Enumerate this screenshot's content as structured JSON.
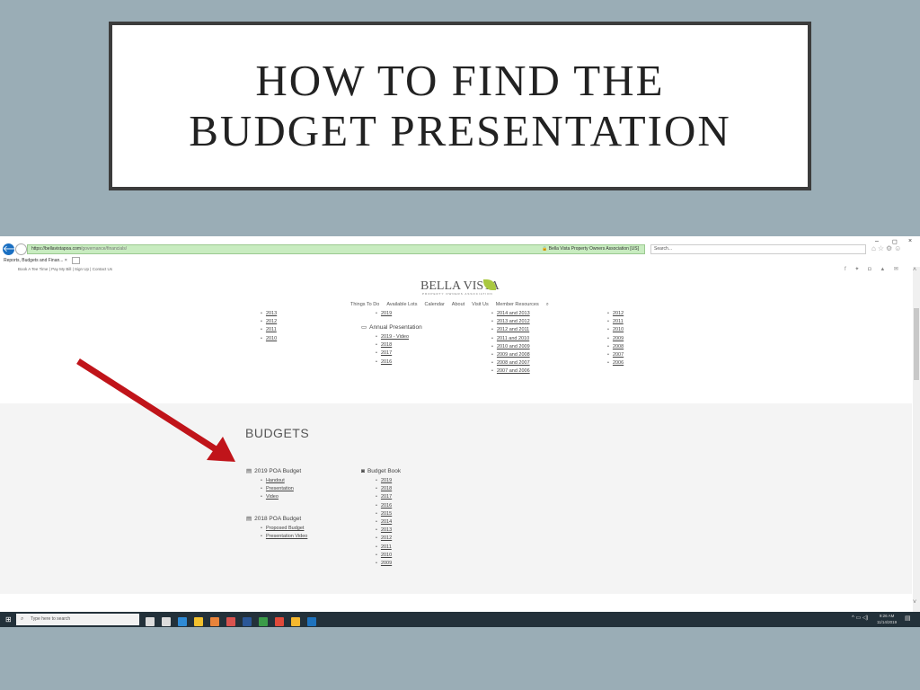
{
  "slide": {
    "title_line1": "HOW TO FIND THE",
    "title_line2": "BUDGET PRESENTATION"
  },
  "browser": {
    "back_glyph": "🡐",
    "address_url_strong": "https://bellavistapoa.com",
    "address_url_rest": "/governance/financials/",
    "site_identity": "Bella Vista Property Owners Association [US]",
    "search_placeholder": "Search...",
    "tab_label": "Reports, Budgets and Finan...",
    "tab_close": "×",
    "window_minimize": "–",
    "window_restore": "◻",
    "window_close": "×",
    "fav_icons": "⌂☆⚙☺"
  },
  "site": {
    "utility_links": "Book A Tee Time | Pay My Bill | Sign Up | Contact Us",
    "social_icons": "f ✦ ◘ ▲ ✉",
    "logo_text": "BELLA VISTA",
    "logo_subtext": "PROPERTY OWNERS ASSOCIATION",
    "menu": [
      "Things To Do",
      "Available Lots",
      "Calendar",
      "About",
      "Visit Us",
      "Member Resources"
    ],
    "menu_search_glyph": "⌕"
  },
  "upper_lists": {
    "col1": [
      "2013",
      "2012",
      "2011",
      "2010"
    ],
    "col2_top": [
      "2019"
    ],
    "annual_presentation_heading": "Annual Presentation",
    "annual_presentation_items": [
      "2019 - Video",
      "2018",
      "2017",
      "2016"
    ],
    "col3": [
      "2014 and 2013",
      "2013 and 2012",
      "2012 and 2011",
      "2011 and 2010",
      "2010 and 2009",
      "2009 and 2008",
      "2008 and 2007",
      "2007 and 2006"
    ],
    "col4": [
      "2012",
      "2011",
      "2010",
      "2009",
      "2008",
      "2007",
      "2006"
    ]
  },
  "budgets": {
    "title": "BUDGETS",
    "poa_2019_heading": "2019 POA Budget",
    "poa_2019_items": [
      "Handout",
      "Presentation",
      "Video"
    ],
    "poa_2018_heading": "2018 POA Budget",
    "poa_2018_items": [
      "Proposed Budget",
      "Presentation Video"
    ],
    "budget_book_heading": "Budget Book",
    "budget_book_items": [
      "2019",
      "2018",
      "2017",
      "2016",
      "2015",
      "2014",
      "2013",
      "2012",
      "2011",
      "2010",
      "2009"
    ]
  },
  "taskbar": {
    "start_glyph": "⊞",
    "search_placeholder": "Type here to search",
    "search_glyph": "⌕",
    "tray_icons": "^ ▭ ◁)",
    "time": "9:26 AM",
    "date": "11/14/2019",
    "notif_glyph": "▤",
    "app_colors": [
      "#dcdcdc",
      "#dcdcdc",
      "#2e8bd6",
      "#f2c12e",
      "#e8833a",
      "#d9534f",
      "#2b5797",
      "#3a9b48",
      "#e04a3a",
      "#f5b82e",
      "#1e73be"
    ]
  },
  "annotation": {
    "arrow_color": "#c0141a"
  }
}
